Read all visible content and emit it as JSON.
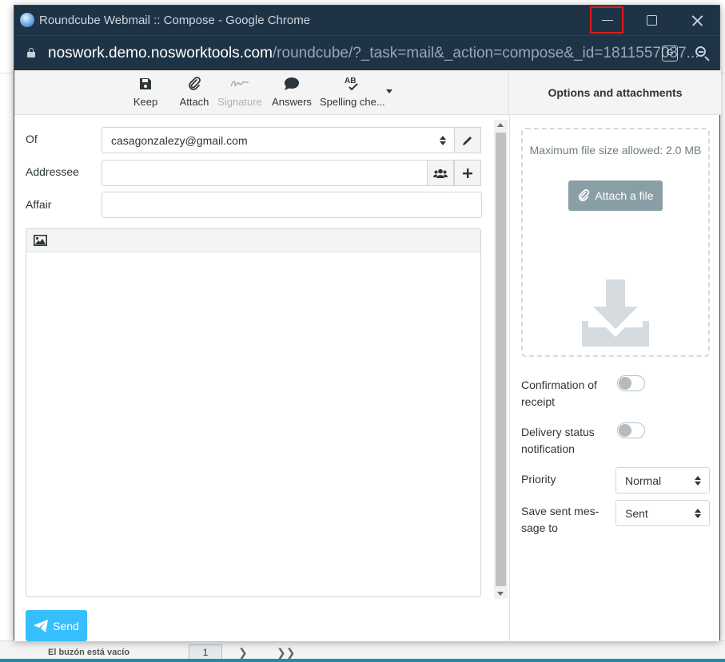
{
  "background": {
    "mailbox_empty": "El buzón está vacío",
    "page_number": "1"
  },
  "window": {
    "title": "Roundcube Webmail :: Compose - Google Chrome",
    "url_host": "noswork.demo.nosworktools.com",
    "url_path": "/roundcube/?_task=mail&_action=compose&_id=1811557037..."
  },
  "toolbar": {
    "keep": "Keep",
    "attach": "Attach",
    "signature": "Signature",
    "answers": "Answers",
    "spelling": "Spelling che..."
  },
  "form": {
    "from_label": "Of",
    "from_value": "casagonzalezy@gmail.com",
    "to_label": "Addressee",
    "to_value": "",
    "subject_label": "Affair",
    "subject_value": "",
    "send_label": "Send"
  },
  "side": {
    "header": "Options and attachments",
    "max_size": "Maximum file size allowed: 2.0 MB",
    "attach_button": "Attach a file",
    "receipt_label": "Confirmation of receipt",
    "receipt_on": false,
    "dsn_label": "Delivery status notification",
    "dsn_on": false,
    "priority_label": "Priority",
    "priority_value": "Normal",
    "save_label": "Save sent mes-sage to",
    "save_value": "Sent"
  },
  "colors": {
    "titlebar": "#1e3346",
    "send_button": "#37beff",
    "attach_button": "#8a9fa5",
    "highlight_box": "#e01b1b"
  }
}
